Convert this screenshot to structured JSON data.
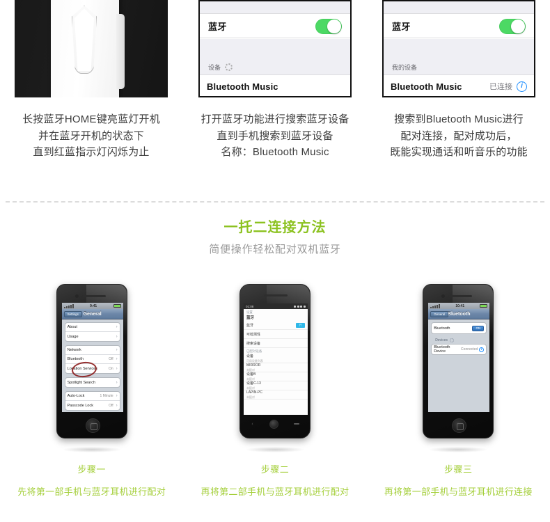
{
  "top_steps": [
    {
      "photo": "bluetooth-device-photo",
      "caption_lines": [
        "长按蓝牙HOME键亮蓝灯开机",
        "并在蓝牙开机的状态下",
        "直到红蓝指示灯闪烁为止"
      ]
    },
    {
      "photo": "ios-bluetooth-searching-screenshot",
      "caption_lines": [
        "打开蓝牙功能进行搜索蓝牙设备",
        "直到手机搜索到蓝牙设备",
        "名称：Bluetooth Music"
      ],
      "screen": {
        "bluetooth_label": "蓝牙",
        "toggle_state": "on",
        "section_header": "设备",
        "device_name": "Bluetooth Music",
        "device_status": "",
        "has_spinner": true,
        "has_info_icon": false
      }
    },
    {
      "photo": "ios-bluetooth-connected-screenshot",
      "caption_lines": [
        "搜索到Bluetooth Music进行",
        "配对连接，配对成功后，",
        "既能实现通话和听音乐的功能"
      ],
      "screen": {
        "bluetooth_label": "蓝牙",
        "toggle_state": "on",
        "section_header": "我的设备",
        "device_name": "Bluetooth Music",
        "device_status": "已连接",
        "has_spinner": false,
        "has_info_icon": true,
        "info_icon_glyph": "i"
      }
    }
  ],
  "section": {
    "title": "一托二连接方法",
    "subtitle": "简便操作轻松配对双机蓝牙",
    "title_color": "#8cc220",
    "subtitle_color": "#9a9a9a"
  },
  "bottom_steps": [
    {
      "label": "步骤一",
      "desc": "先将第一部手机与蓝牙耳机进行配对",
      "device": "iphone-general-settings",
      "screen": {
        "status_clock": "9:41",
        "nav_back": "Settings",
        "nav_title": "General",
        "rows_group1": [
          {
            "label": "About",
            "value": ""
          },
          {
            "label": "Usage",
            "value": ""
          }
        ],
        "rows_group2": [
          {
            "label": "Network",
            "value": ""
          },
          {
            "label": "Bluetooth",
            "value": "Off"
          },
          {
            "label": "Location Services",
            "value": "On"
          }
        ],
        "rows_group3": [
          {
            "label": "Spotlight Search",
            "value": ""
          }
        ],
        "rows_group4": [
          {
            "label": "Auto-Lock",
            "value": "1 Minute"
          },
          {
            "label": "Passcode Lock",
            "value": "Off"
          }
        ],
        "highlight": "Bluetooth"
      }
    },
    {
      "label": "步骤二",
      "desc": "再将第二部手机与蓝牙耳机进行配对",
      "device": "android-bluetooth-settings",
      "screen": {
        "status_clock": "01:08",
        "header_small": "设置",
        "header_title": "蓝牙",
        "rows": [
          {
            "label": "蓝牙",
            "sub": "",
            "toggle": "开"
          },
          {
            "label": "可检测性",
            "sub": ""
          },
          {
            "label": "搜索设备",
            "sub": ""
          },
          {
            "label": "已配对设备",
            "sub": ""
          },
          {
            "label": "设备",
            "sub": "可用设备列表"
          },
          {
            "label": "MIRROR",
            "sub": "未配对"
          },
          {
            "label": "设备B",
            "sub": "未配对"
          },
          {
            "label": "设备C-13",
            "sub": "未配对"
          },
          {
            "label": "LAPIN-PC",
            "sub": "未配对"
          }
        ]
      }
    },
    {
      "label": "步骤三",
      "desc": "再将第一部手机与蓝牙耳机进行连接",
      "device": "iphone-bluetooth-settings",
      "screen": {
        "status_clock": "10:41",
        "nav_back": "General",
        "nav_title": "Bluetooth",
        "bluetooth_row_label": "Bluetooth",
        "bluetooth_toggle": "ON",
        "devices_header": "Devices",
        "device_name": "Bluetooth Device",
        "device_status": "Connected",
        "info_icon_glyph": "i"
      }
    }
  ],
  "colors": {
    "green_accent": "#8cc220",
    "step_text_green": "#a4cf3a",
    "ios_toggle_green": "#4cd964",
    "info_blue": "#1e8fff",
    "caption_gray": "#3d3d3d",
    "divider_gray": "#dcdcdc"
  }
}
